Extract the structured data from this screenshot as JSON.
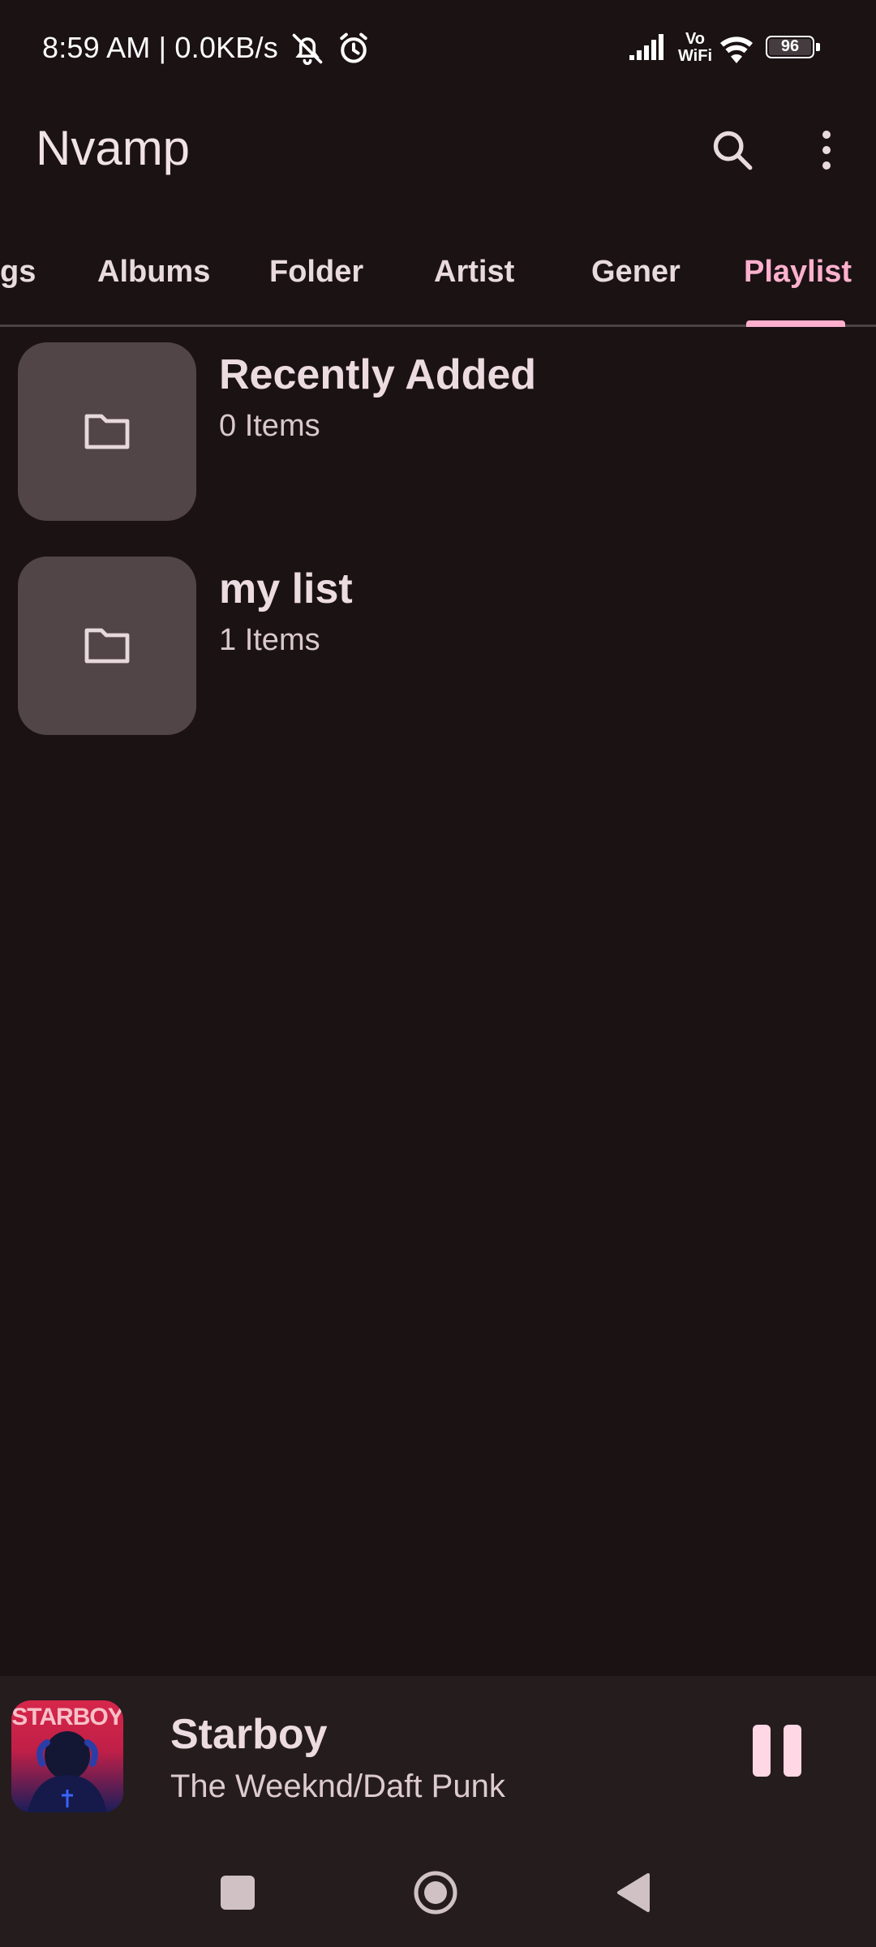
{
  "status_bar": {
    "time": "8:59 AM | 0.0KB/s",
    "vowifi_line1": "Vo",
    "vowifi_line2": "WiFi",
    "battery": "96",
    "icons": [
      "mute-bell-icon",
      "alarm-icon",
      "signal-icon",
      "vowifi-icon",
      "wifi-icon",
      "battery-icon"
    ]
  },
  "app_bar": {
    "title": "Nvamp",
    "icons": [
      "search-icon",
      "more-vert-icon"
    ]
  },
  "tabs": [
    {
      "label": "gs",
      "active": false
    },
    {
      "label": "Albums",
      "active": false
    },
    {
      "label": "Folder",
      "active": false
    },
    {
      "label": "Artist",
      "active": false
    },
    {
      "label": "Gener",
      "active": false
    },
    {
      "label": "Playlist",
      "active": true
    }
  ],
  "playlists": [
    {
      "title": "Recently Added",
      "count": "0 Items",
      "icon": "folder-icon"
    },
    {
      "title": "my list",
      "count": "1 Items",
      "icon": "folder-icon"
    }
  ],
  "mini_player": {
    "album_art_text": "STARBOY",
    "title": "Starboy",
    "artist": "The Weeknd/Daft Punk",
    "control_icon": "pause-icon"
  },
  "nav_bar": {
    "icons": [
      "recents-square-icon",
      "home-circle-icon",
      "back-triangle-icon"
    ]
  },
  "colors": {
    "background": "#1b1214",
    "accent": "#ffb0cd",
    "thumb": "#524547",
    "player_bg": "#251c1e"
  }
}
